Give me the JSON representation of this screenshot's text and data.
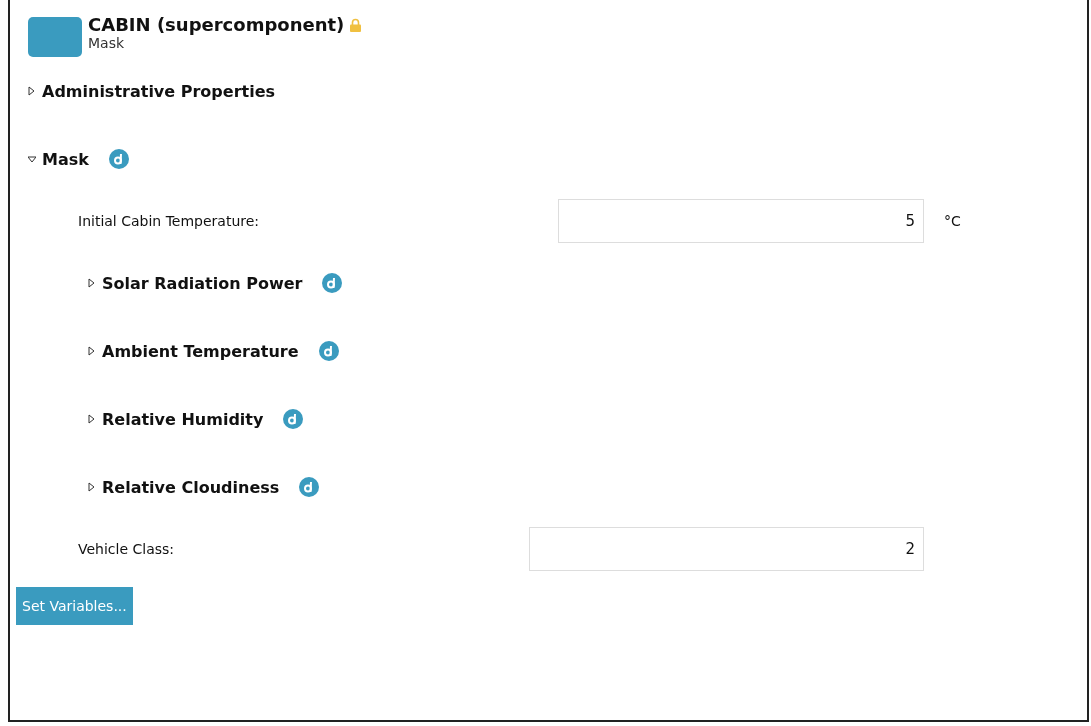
{
  "header": {
    "title": "CABIN (supercomponent)",
    "subtitle": "Mask",
    "locked": true
  },
  "sections": [
    {
      "kind": "section",
      "label": "Administrative Properties",
      "expanded": false,
      "has_default": false
    },
    {
      "kind": "section",
      "label": "Mask",
      "expanded": true,
      "has_default": true,
      "children": [
        {
          "kind": "field",
          "label": "Initial Cabin Temperature:",
          "value": "5",
          "unit": "°C"
        },
        {
          "kind": "section",
          "label": "Solar Radiation Power",
          "expanded": false,
          "has_default": true
        },
        {
          "kind": "section",
          "label": "Ambient Temperature",
          "expanded": false,
          "has_default": true
        },
        {
          "kind": "section",
          "label": "Relative Humidity",
          "expanded": false,
          "has_default": true
        },
        {
          "kind": "section",
          "label": "Relative Cloudiness",
          "expanded": false,
          "has_default": true
        },
        {
          "kind": "field",
          "label": "Vehicle Class:",
          "value": "2"
        }
      ]
    }
  ],
  "button": "Set Variables..."
}
